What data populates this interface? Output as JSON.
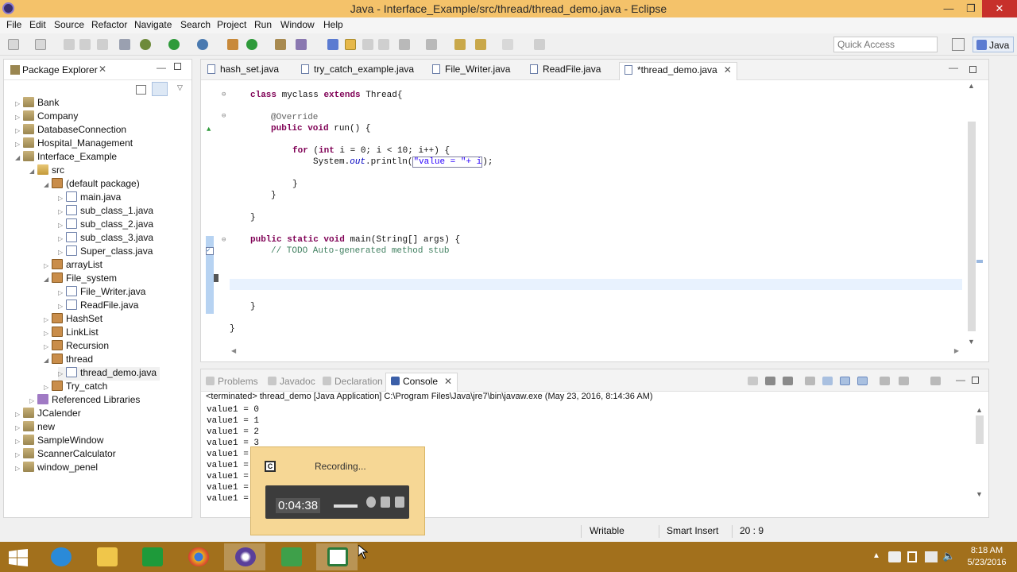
{
  "window": {
    "title": "Java - Interface_Example/src/thread/thread_demo.java - Eclipse",
    "minimize": "—",
    "restore": "❐",
    "close": "✕"
  },
  "menu": [
    "File",
    "Edit",
    "Source",
    "Refactor",
    "Navigate",
    "Search",
    "Project",
    "Run",
    "Window",
    "Help"
  ],
  "toolbar": {
    "quick_access_placeholder": "Quick Access",
    "perspective": "Java"
  },
  "package_explorer": {
    "title": "Package Explorer",
    "close": "✕",
    "minimize": "—",
    "items": [
      {
        "label": "Bank",
        "arrow": "▷",
        "icon": "project-icon"
      },
      {
        "label": "Company",
        "arrow": "▷",
        "icon": "project-icon"
      },
      {
        "label": "DatabaseConnection",
        "arrow": "▷",
        "icon": "project-icon"
      },
      {
        "label": "Hospital_Management",
        "arrow": "▷",
        "icon": "project-icon"
      },
      {
        "label": "Interface_Example",
        "arrow": "◢",
        "icon": "project-icon"
      },
      {
        "label": "src",
        "arrow": "◢",
        "icon": "source-folder-icon"
      },
      {
        "label": "(default package)",
        "arrow": "◢",
        "icon": "package-icon"
      },
      {
        "label": "main.java",
        "arrow": "▷",
        "icon": "java-file-icon"
      },
      {
        "label": "sub_class_1.java",
        "arrow": "▷",
        "icon": "java-file-icon"
      },
      {
        "label": "sub_class_2.java",
        "arrow": "▷",
        "icon": "java-file-icon"
      },
      {
        "label": "sub_class_3.java",
        "arrow": "▷",
        "icon": "java-file-icon"
      },
      {
        "label": "Super_class.java",
        "arrow": "▷",
        "icon": "java-file-icon"
      },
      {
        "label": "arrayList",
        "arrow": "▷",
        "icon": "package-icon"
      },
      {
        "label": "File_system",
        "arrow": "◢",
        "icon": "package-icon"
      },
      {
        "label": "File_Writer.java",
        "arrow": "▷",
        "icon": "java-file-icon"
      },
      {
        "label": "ReadFile.java",
        "arrow": "▷",
        "icon": "java-file-icon"
      },
      {
        "label": "HashSet",
        "arrow": "▷",
        "icon": "package-icon"
      },
      {
        "label": "LinkList",
        "arrow": "▷",
        "icon": "package-icon"
      },
      {
        "label": "Recursion",
        "arrow": "▷",
        "icon": "package-icon"
      },
      {
        "label": "thread",
        "arrow": "◢",
        "icon": "package-icon"
      },
      {
        "label": "thread_demo.java",
        "arrow": "▷",
        "icon": "java-file-icon"
      },
      {
        "label": "Try_catch",
        "arrow": "▷",
        "icon": "package-icon"
      },
      {
        "label": "Referenced Libraries",
        "arrow": "▷",
        "icon": "library-icon"
      },
      {
        "label": "JCalender",
        "arrow": "▷",
        "icon": "project-icon"
      },
      {
        "label": "new",
        "arrow": "▷",
        "icon": "project-icon"
      },
      {
        "label": "SampleWindow",
        "arrow": "▷",
        "icon": "project-icon"
      },
      {
        "label": "ScannerCalculator",
        "arrow": "▷",
        "icon": "project-icon"
      },
      {
        "label": "window_penel",
        "arrow": "▷",
        "icon": "project-icon"
      }
    ]
  },
  "editor": {
    "tabs": [
      {
        "label": "hash_set.java"
      },
      {
        "label": "try_catch_example.java"
      },
      {
        "label": "File_Writer.java"
      },
      {
        "label": "ReadFile.java"
      },
      {
        "label": "*thread_demo.java",
        "close": "✕"
      }
    ],
    "code": {
      "l1_kw1": "class",
      "l1_name": " myclass ",
      "l1_kw2": "extends",
      "l1_rest": " Thread{",
      "l2_ann": "@Override",
      "l3_kw1": "public",
      "l3_kw2": " void",
      "l3_rest": " run() {",
      "l4_kw1": "for",
      "l4_a": " (",
      "l4_kw2": "int",
      "l4_rest": " i = 0; i < 10; i++) {",
      "l5_a": "System.",
      "l5_fld": "out",
      "l5_b": ".println(",
      "l5_str": "\"value = \"+ i",
      "l5_c": ");",
      "l6": "}",
      "l7": "}",
      "l8": "}",
      "l9_kw1": "public",
      "l9_kw2": " static",
      "l9_kw3": " void",
      "l9_rest": " main(String[] args) {",
      "l10_cm": "// TODO Auto-generated method stub",
      "l11": "}",
      "l12": "}"
    }
  },
  "console": {
    "tabs": [
      {
        "label": "Problems"
      },
      {
        "label": "Javadoc"
      },
      {
        "label": "Declaration"
      },
      {
        "label": "Console",
        "close": "✕"
      }
    ],
    "terminated": "<terminated> thread_demo [Java Application] C:\\Program Files\\Java\\jre7\\bin\\javaw.exe (May 23, 2016, 8:14:36 AM)",
    "lines": [
      "value1 = 0",
      "value1 = 1",
      "value1 = 2",
      "value1 = 3",
      "value1 =",
      "value1 =",
      "value1 =",
      "value1 =",
      "value1 ="
    ]
  },
  "status": {
    "writable": "Writable",
    "insert_mode": "Smart Insert",
    "position": "20 : 9"
  },
  "recorder": {
    "label": "Recording...",
    "time": "0:04:38"
  },
  "taskbar": {
    "clock_time": "8:18 AM",
    "clock_date": "5/23/2016"
  }
}
